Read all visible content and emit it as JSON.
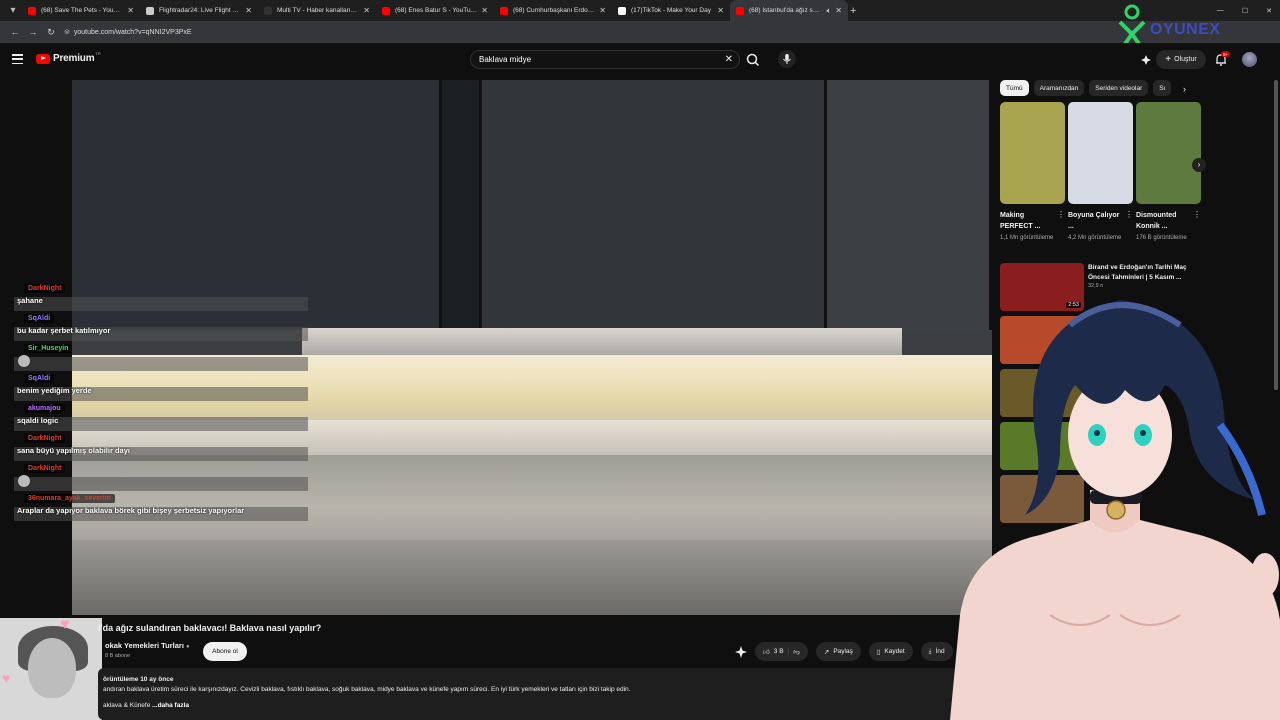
{
  "browser": {
    "tabs": [
      {
        "title": "(68) Save The Pets - YouTube",
        "color": "#ff0000",
        "active": false
      },
      {
        "title": "Flightradar24: Live Flight Tracker",
        "color": "#cccccc",
        "active": false
      },
      {
        "title": "Multi TV - Haber kanallarını ay",
        "color": "#333333",
        "active": false
      },
      {
        "title": "(68) Enes Batur S - YouTube",
        "color": "#ff0000",
        "active": false
      },
      {
        "title": "(68) Cumhurbaşkanı Erdoğan C",
        "color": "#ff0000",
        "active": false
      },
      {
        "title": "(17)TikTok - Make Your Day",
        "color": "#ffffff",
        "active": false
      },
      {
        "title": "(68) İstanbul'da ağız sulan",
        "color": "#ff0000",
        "active": true
      }
    ],
    "url": "youtube.com/watch?v=qNNI2VP3PxE"
  },
  "youtube": {
    "brand": "Premium",
    "brand_sup": "TR",
    "search_value": "Baklava midye",
    "create_label": "Oluştur",
    "notif_badge": "9+"
  },
  "overlay_logo_text": "OYUNEX",
  "chat": [
    {
      "name": "DarkNight",
      "text": "şahane",
      "color": "#e0392d"
    },
    {
      "name": "SqAldi",
      "text": "bu kadar şerbet katılmıyor",
      "color": "#8f7bff"
    },
    {
      "name": "Sir_Huseyin",
      "text": "",
      "color": "#4bd36a",
      "emote": true
    },
    {
      "name": "SqAldi",
      "text": "benim yediğim yerde",
      "color": "#8f7bff"
    },
    {
      "name": "akumajou",
      "text": "sqaldi logic",
      "color": "#b46cff"
    },
    {
      "name": "DarkNight",
      "text": "sana büyü yapılmış olabilir dayı",
      "color": "#e0392d"
    },
    {
      "name": "DarkNight",
      "text": "",
      "color": "#e0392d",
      "emote": true
    },
    {
      "name": "36numara_ayak_severim",
      "text": "Araplar da yapıyor baklava börek gibi bişey şerbetsiz yapıyorlar",
      "color": "#e0392d"
    }
  ],
  "video": {
    "title": "l'da ağız sulandıran baklavacı! Baklava nasıl yapılır?",
    "channel": "okak Yemekleri Turları",
    "subscribers": "8 B abone",
    "subscribe_label": "Abone ol",
    "likes": "3 B",
    "share_label": "Paylaş",
    "save_label": "Kaydet",
    "download_label": "İnd",
    "views_time": "örüntüleme  10 ay önce",
    "desc_line": "andıran baklava üretim süreci ile karşınızdayız. Cevizli baklava, fıstıklı baklava, soğuk baklava, midye baklava ve künefe yapım süreci. En iyi türk yemekleri ve tatları için bizi takip edin.",
    "desc_tags": "aklava & Künefe ",
    "desc_more": "...daha fazla"
  },
  "sidebar": {
    "chips": [
      "Tümü",
      "Aramanızdan",
      "Seriden videolar",
      "Sı"
    ],
    "shorts": [
      {
        "title": "Making PERFECT ...",
        "views": "1,1 Mn görüntüleme",
        "color": "#a7a34e"
      },
      {
        "title": "Boyuna Çalıyor ...",
        "views": "4,2 Mn görüntüleme",
        "color": "#d6dbe6"
      },
      {
        "title": "Dismounted Konnik ...",
        "views": "176 B görüntüleme",
        "color": "#5f7a3e"
      }
    ],
    "recs": [
      {
        "title": "Birand ve Erdoğan'ın Tarihi Maç Öncesi Tahminleri | 5 Kasım ...",
        "views": "32,9 n",
        "duration": "2:53",
        "color": "#8a1e1e"
      },
      {
        "title": "",
        "views": "",
        "duration": "",
        "color": "#b64a2b"
      },
      {
        "title": "",
        "views": "",
        "duration": "",
        "color": "#6a5a2a"
      },
      {
        "title": "",
        "views": "",
        "duration": "",
        "color": "#5a7a2a"
      },
      {
        "title": "",
        "views": "",
        "duration": "",
        "color": "#7a5a3a"
      }
    ]
  }
}
